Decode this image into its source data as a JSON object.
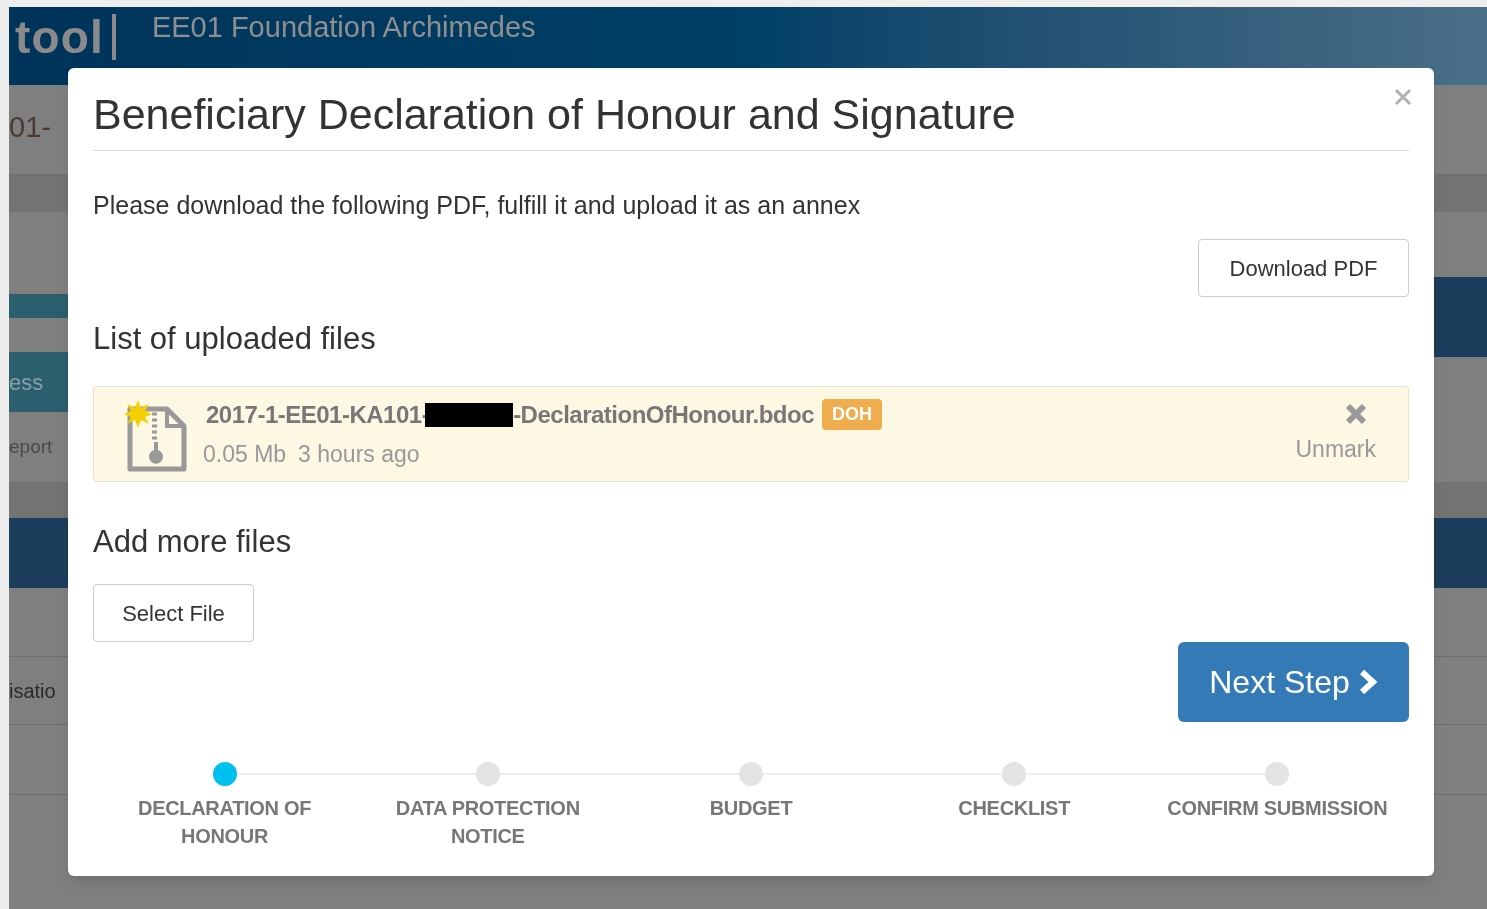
{
  "background": {
    "brand": "tool",
    "organisation": "EE01 Foundation Archimedes",
    "fragments": [
      "01-",
      "ess",
      "eport",
      "isatio"
    ]
  },
  "modal": {
    "title": "Beneficiary Declaration of Honour and Signature",
    "instruction": "Please download the following PDF, fulfill it and upload it as an annex",
    "download_button": "Download PDF",
    "uploaded_heading": "List of uploaded files",
    "files": [
      {
        "name_start": "2017-1-EE01-KA101-",
        "redacted": true,
        "name_end": "-DeclarationOfHonour.bdoc",
        "tag": "DOH",
        "size": "0.05 Mb",
        "age": "3 hours ago",
        "new": true,
        "action": "Unmark"
      }
    ],
    "add_heading": "Add more files",
    "select_button": "Select File",
    "next_button": "Next Step",
    "steps": [
      {
        "label": "DECLARATION OF HONOUR",
        "selected": true
      },
      {
        "label": "DATA PROTECTION NOTICE",
        "selected": false
      },
      {
        "label": "BUDGET",
        "selected": false
      },
      {
        "label": "CHECKLIST",
        "selected": false
      },
      {
        "label": "CONFIRM SUBMISSION",
        "selected": false
      }
    ]
  }
}
